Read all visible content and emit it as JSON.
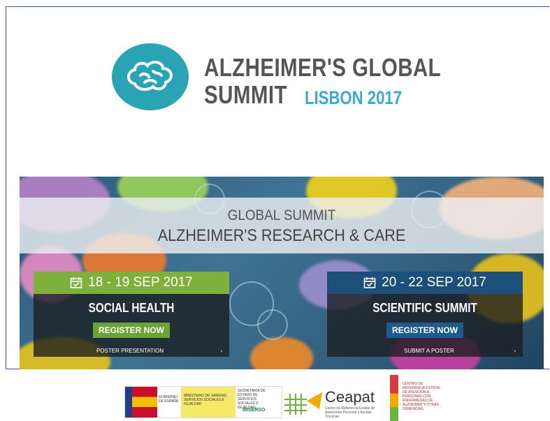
{
  "logo": {
    "line1": "ALZHEIMER'S GLOBAL",
    "line2": "SUMMIT",
    "city": "LISBON 2017",
    "icon": "brain-icon"
  },
  "banner": {
    "title_1": "GLOBAL SUMMIT",
    "title_2": "ALZHEIMER'S RESEARCH & CARE",
    "cards": [
      {
        "date": "18 - 19 SEP 2017",
        "title": "SOCIAL HEALTH",
        "button": "REGISTER NOW",
        "footer": "POSTER PRESENTATION",
        "footer_arrow": "›",
        "accent": "#7fb03c"
      },
      {
        "date": "20 - 22 SEP 2017",
        "title": "SCIENTIFIC SUMMIT",
        "button": "REGISTER NOW",
        "footer": "SUBMIT A POSTER",
        "footer_arrow": "›",
        "accent": "#1c4f7a"
      }
    ]
  },
  "sponsors": {
    "gov_1": "GOBIERNO DE ESPAÑA",
    "gov_2": "MINISTERIO DE SANIDAD, SERVICIOS SOCIALES E IGUALDAD",
    "gov_3": "SECRETARÍA DE ESTADO DE SERVICIOS SOCIALES E IGUALDAD",
    "imserso": "IMSERSO",
    "ceapat": "Ceapat",
    "ceapat_sub": "Centro de Referencia Estatal de Autonomía Personal y Ayudas Técnicas",
    "centro": "CENTRO DE REFERENCIA ESTATAL DE ATENCIÓN A PERSONAS CON ENFERMEDAD DE ALZHEIMER Y OTRAS DEMENCIAS"
  }
}
